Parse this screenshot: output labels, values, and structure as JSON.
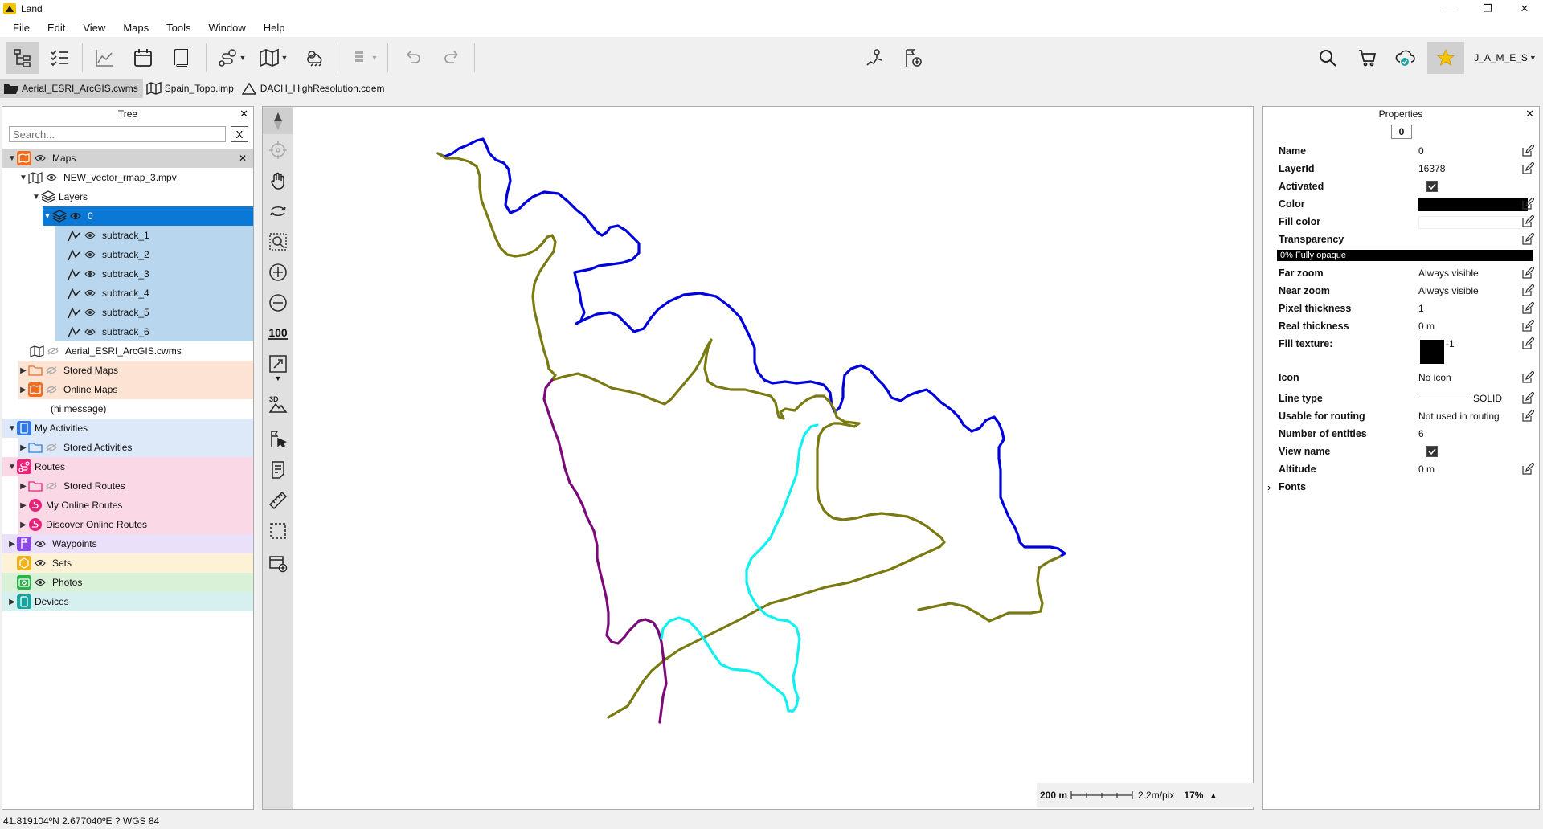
{
  "window": {
    "title": "Land",
    "minimize": "—",
    "restore": "❐",
    "close": "✕"
  },
  "menu": [
    "File",
    "Edit",
    "View",
    "Maps",
    "Tools",
    "Window",
    "Help"
  ],
  "toolbar": {
    "user_label": "J_A_M_E_S"
  },
  "file_tabs": [
    {
      "label": "Aerial_ESRI_ArcGIS.cwms",
      "active": true
    },
    {
      "label": "Spain_Topo.imp",
      "active": false
    },
    {
      "label": "DACH_HighResolution.cdem",
      "active": false
    }
  ],
  "tree": {
    "title": "Tree",
    "close": "✕",
    "search_placeholder": "Search...",
    "search_clear": "X",
    "items": [
      {
        "label": "Maps",
        "close": "✕"
      },
      {
        "label": "NEW_vector_rmap_3.mpv"
      },
      {
        "label": "Layers"
      },
      {
        "label": "0"
      },
      {
        "label": "subtrack_1"
      },
      {
        "label": "subtrack_2"
      },
      {
        "label": "subtrack_3"
      },
      {
        "label": "subtrack_4"
      },
      {
        "label": "subtrack_5"
      },
      {
        "label": "subtrack_6"
      },
      {
        "label": "Aerial_ESRI_ArcGIS.cwms"
      },
      {
        "label": "Stored Maps"
      },
      {
        "label": "Online Maps"
      },
      {
        "label": "(ni message)"
      },
      {
        "label": "My Activities"
      },
      {
        "label": "Stored Activities"
      },
      {
        "label": "Routes"
      },
      {
        "label": "Stored Routes"
      },
      {
        "label": "My Online Routes"
      },
      {
        "label": "Discover Online Routes"
      },
      {
        "label": "Waypoints"
      },
      {
        "label": "Sets"
      },
      {
        "label": "Photos"
      },
      {
        "label": "Devices"
      }
    ]
  },
  "map_toolbar": {
    "zoom_100_label": "100",
    "view_3d_label": "3D"
  },
  "scale": {
    "distance": "200 m",
    "resolution": "2.2m/pix",
    "zoom": "17%"
  },
  "colors": {
    "track_blue": "#0000dd",
    "track_olive": "#7a7a12",
    "track_purple": "#7a0a7a",
    "track_cyan": "#10f0f0",
    "selection": "#0a78d7",
    "selection_light": "#b8d6ee"
  },
  "properties": {
    "title": "Properties",
    "close": "✕",
    "header_value": "0",
    "rows": [
      {
        "label": "Name",
        "value": "0"
      },
      {
        "label": "LayerId",
        "value": "16378"
      },
      {
        "label": "Activated",
        "value": ""
      },
      {
        "label": "Color",
        "value": ""
      },
      {
        "label": "Fill color",
        "value": ""
      },
      {
        "label": "Transparency",
        "value": ""
      },
      {
        "label": "Far zoom",
        "value": "Always visible"
      },
      {
        "label": "Near zoom",
        "value": "Always visible"
      },
      {
        "label": "Pixel thickness",
        "value": "1"
      },
      {
        "label": "Real thickness",
        "value": "0 m"
      },
      {
        "label": "Fill texture:",
        "value": "-1"
      },
      {
        "label": "Icon",
        "value": "No icon"
      },
      {
        "label": "Line type",
        "value": "SOLID"
      },
      {
        "label": "Usable for routing",
        "value": "Not used in routing"
      },
      {
        "label": "Number of entities",
        "value": "6"
      },
      {
        "label": "View name",
        "value": ""
      },
      {
        "label": "Altitude",
        "value": "0 m"
      },
      {
        "label": "Fonts",
        "value": ""
      }
    ],
    "transparency_text": "0% Fully opaque",
    "fonts_toggle": "›"
  },
  "status": {
    "coords": "41.819104ºN 2.677040ºE  ?  WGS 84"
  }
}
